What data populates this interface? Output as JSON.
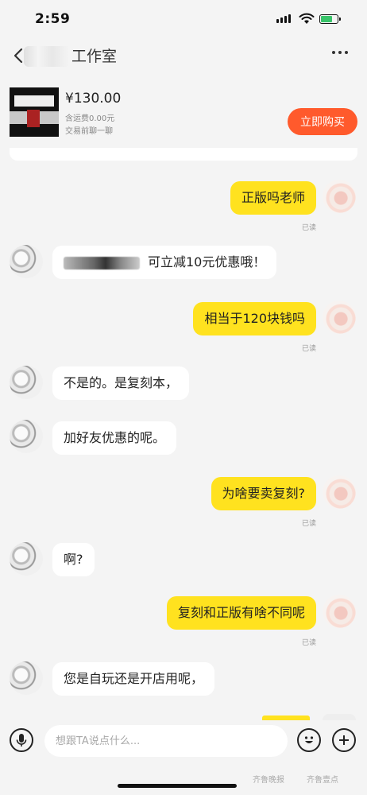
{
  "status_bar": {
    "time": "2:59",
    "battery_level": 0.75,
    "battery_color": "#39c46a"
  },
  "header": {
    "title": "工作室",
    "more_icon": "more-dots-icon",
    "back_icon": "chevron-left-icon"
  },
  "product": {
    "price": "¥130.00",
    "shipping": "含运费0.00元",
    "note": "交易前聊一聊",
    "buy_button": "立即购买"
  },
  "colors": {
    "my_bubble": "#ffe21f",
    "their_bubble": "#ffffff",
    "buy_button": "#ff5a2c",
    "background": "#f4f4f4"
  },
  "messages": [
    {
      "sender": "me",
      "text": "正版吗老师",
      "status": "已读"
    },
    {
      "sender": "them",
      "text": "可立减10元优惠哦！"
    },
    {
      "sender": "me",
      "text": "相当于120块钱吗",
      "status": "已读"
    },
    {
      "sender": "them",
      "text": "不是的。是复刻本，"
    },
    {
      "sender": "them",
      "text": "加好友优惠的呢。"
    },
    {
      "sender": "me",
      "text": "为啥要卖复刻?",
      "status": "已读"
    },
    {
      "sender": "them",
      "text": "啊?"
    },
    {
      "sender": "me",
      "text": "复刻和正版有啥不同呢",
      "status": "已读"
    },
    {
      "sender": "them",
      "text": "您是自玩还是开店用呢，"
    }
  ],
  "composer": {
    "placeholder": "想跟TA说点什么..."
  },
  "watermark": {
    "left": "齐鲁晚报",
    "right": "齐鲁壹点"
  }
}
